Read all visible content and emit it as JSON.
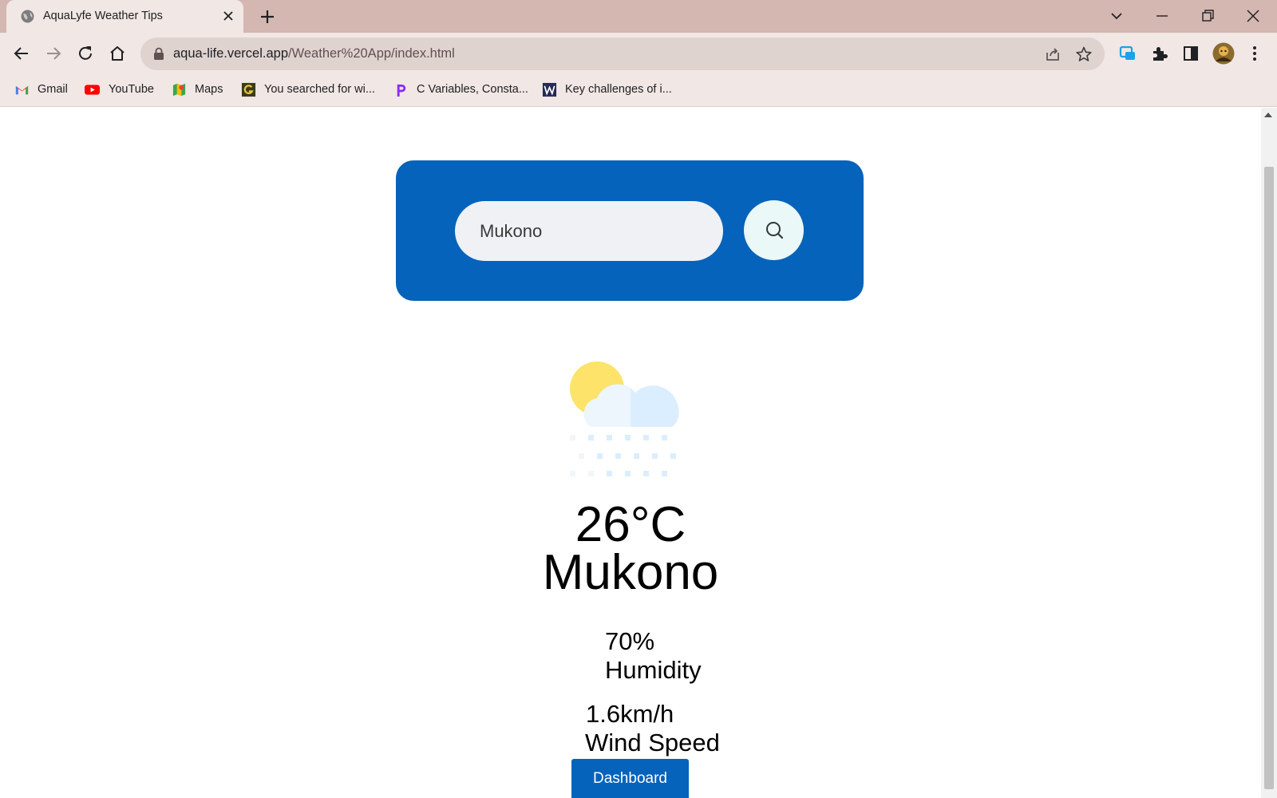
{
  "browser": {
    "tab_title": "AquaLyfe Weather Tips",
    "url_host": "aqua-life.vercel.app",
    "url_path": "/Weather%20App/index.html",
    "bookmarks": [
      {
        "label": "Gmail",
        "icon": "gmail-icon"
      },
      {
        "label": "YouTube",
        "icon": "youtube-icon"
      },
      {
        "label": "Maps",
        "icon": "maps-icon"
      },
      {
        "label": "You searched for wi...",
        "icon": "grammar-site-icon"
      },
      {
        "label": "C Variables, Consta...",
        "icon": "programiz-icon"
      },
      {
        "label": "Key challenges of i...",
        "icon": "wp-site-icon"
      }
    ]
  },
  "search": {
    "value": "Mukono",
    "button_icon": "search-icon"
  },
  "weather": {
    "icon": "sun-cloud-snow-icon",
    "temperature": "26°C",
    "city": "Mukono",
    "humidity_value": "70%",
    "humidity_label": "Humidity",
    "wind_value": "1.6km/h",
    "wind_label": "Wind Speed"
  },
  "actions": {
    "dashboard_label": "Dashboard"
  },
  "colors": {
    "brand_blue": "#0563bb",
    "chrome_frame": "#d4b7b0",
    "chrome_toolbar": "#f1e7e4"
  }
}
